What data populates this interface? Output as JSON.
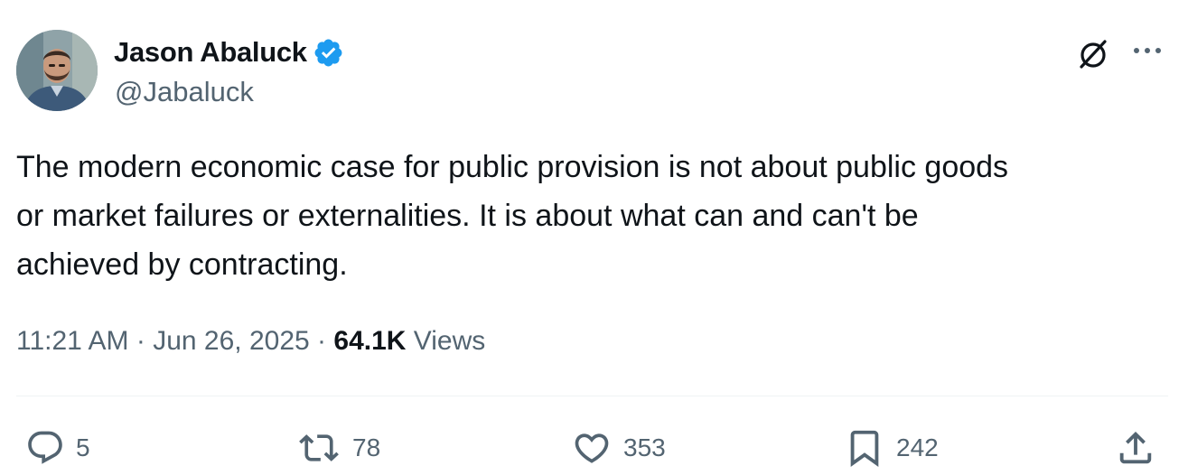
{
  "author": {
    "display_name": "Jason Abaluck",
    "handle": "@Jabaluck",
    "verified_color": "#1d9bf0"
  },
  "tweet": {
    "text_lines": [
      "The modern economic case for public provision is not about public goods",
      "or market failures or externalities. It is about what can and can't be",
      "achieved by contracting."
    ],
    "time": "11:21 AM",
    "separator": "·",
    "date": "Jun 26, 2025",
    "views_count": "64.1K",
    "views_label": "Views"
  },
  "actions": {
    "replies": "5",
    "reposts": "78",
    "likes": "353",
    "bookmarks": "242"
  },
  "icons": {
    "grok": "grok-icon",
    "more": "more-icon",
    "reply": "reply-icon",
    "repost": "repost-icon",
    "like": "heart-icon",
    "bookmark": "bookmark-icon",
    "share": "share-icon"
  },
  "colors": {
    "text_primary": "#0f1419",
    "text_secondary": "#536471",
    "divider": "#eff3f4",
    "verified": "#1d9bf0"
  }
}
